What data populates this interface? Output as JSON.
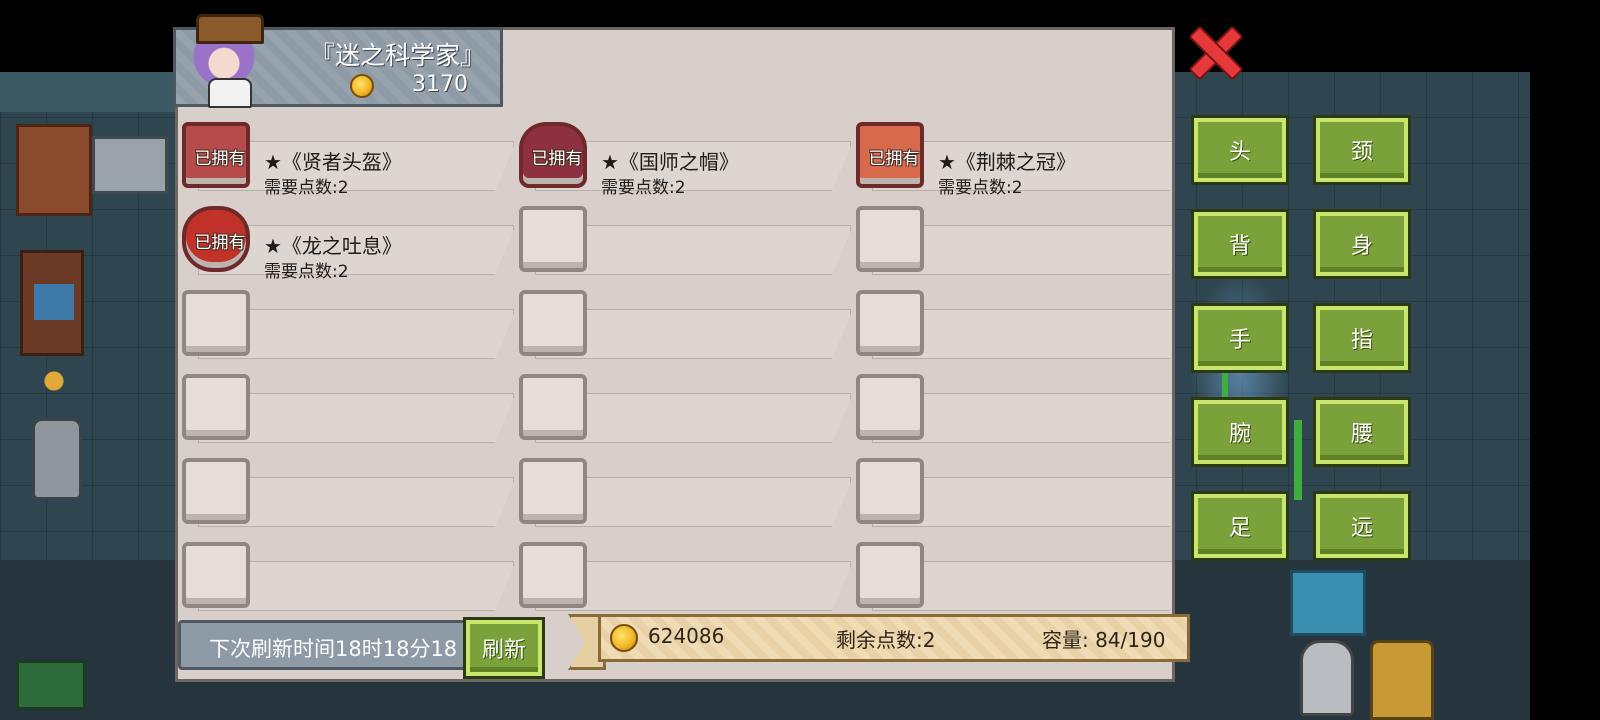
{
  "header": {
    "title": "『迷之科学家』",
    "coins": "3170"
  },
  "owned_tag": "已拥有",
  "items": [
    {
      "name": "★《贤者头盔》",
      "cost": "需要点数:2",
      "owned": true
    },
    {
      "name": "★《国师之帽》",
      "cost": "需要点数:2",
      "owned": true
    },
    {
      "name": "★《荆棘之冠》",
      "cost": "需要点数:2",
      "owned": true
    },
    {
      "name": "★《龙之吐息》",
      "cost": "需要点数:2",
      "owned": true
    }
  ],
  "empty_slots": 14,
  "categories": [
    "头",
    "颈",
    "背",
    "身",
    "手",
    "指",
    "腕",
    "腰",
    "足",
    "远"
  ],
  "footer": {
    "refresh_timer": "下次刷新时间18时18分18",
    "refresh_button": "刷新",
    "money": "624086",
    "remaining_points": "剩余点数:2",
    "capacity": "容量:  84/190"
  },
  "close_icon": "close-icon",
  "colors": {
    "button_green": "#7ba23a",
    "button_border": "#c7e66b",
    "close_red": "#e63a3a",
    "panel_bg": "#d8cfca",
    "header_bg": "#8e9aa6",
    "ribbon_bg": "#efdcb4"
  }
}
